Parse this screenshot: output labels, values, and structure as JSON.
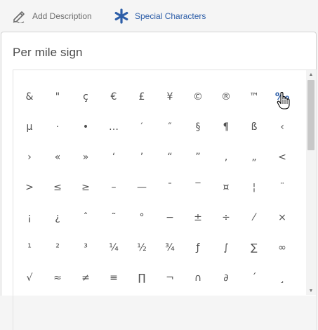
{
  "toolbar": {
    "add_description_label": "Add Description",
    "special_characters_label": "Special Characters",
    "add_description_icon": "pen-icon",
    "special_characters_icon": "asterisk-icon",
    "accent_color": "#2d5ea8"
  },
  "panel": {
    "title": "Per mile sign"
  },
  "characters": [
    "&",
    "\"",
    "ç",
    "€",
    "£",
    "¥",
    "©",
    "®",
    "™",
    "‰",
    "µ",
    "·",
    "•",
    "…",
    "′",
    "″",
    "§",
    "¶",
    "ß",
    "‹",
    "›",
    "«",
    "»",
    "‘",
    "’",
    "“",
    "”",
    "‚",
    "„",
    "<",
    ">",
    "≤",
    "≥",
    "–",
    "—",
    "¯",
    "‾",
    "¤",
    "¦",
    "¨",
    "¡",
    "¿",
    "ˆ",
    "˜",
    "°",
    "−",
    "±",
    "÷",
    "⁄",
    "×",
    "¹",
    "²",
    "³",
    "¼",
    "½",
    "¾",
    "ƒ",
    "∫",
    "∑",
    "∞",
    "√",
    "≈",
    "≠",
    "≡",
    "∏",
    "¬",
    "∩",
    "∂",
    "´",
    "¸"
  ],
  "selected_index": 9
}
